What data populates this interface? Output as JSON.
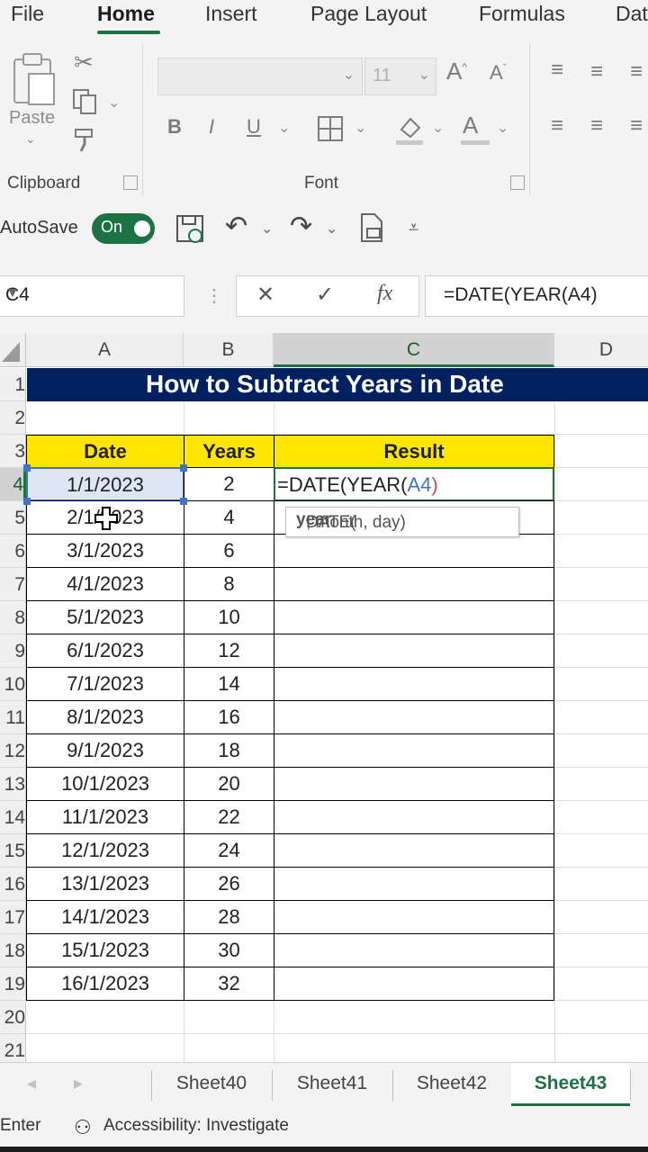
{
  "menu": {
    "tabs": [
      "File",
      "Home",
      "Insert",
      "Page Layout",
      "Formulas",
      "Dat"
    ],
    "active": "Home"
  },
  "ribbon": {
    "paste_label": "Paste",
    "font_size": "11",
    "clipboard_label": "Clipboard",
    "font_label": "Font"
  },
  "qat": {
    "autosave_label": "AutoSave",
    "toggle_label": "On"
  },
  "formula_bar": {
    "name_box": "C4",
    "formula": "=DATE(YEAR(A4)",
    "cancel_glyph": "✕",
    "enter_glyph": "✓",
    "fx_glyph": "fx"
  },
  "sheet": {
    "columns": [
      "A",
      "B",
      "C",
      "D"
    ],
    "row_numbers": [
      "1",
      "2",
      "3",
      "4",
      "5",
      "6",
      "7",
      "8",
      "9",
      "10",
      "11",
      "12",
      "13",
      "14",
      "15",
      "16",
      "17",
      "18",
      "19",
      "20",
      "21"
    ],
    "title": "How to Subtract Years in Date",
    "headers": [
      "Date",
      "Years",
      "Result"
    ],
    "dates": [
      "1/1/2023",
      "2/1/2023",
      "3/1/2023",
      "4/1/2023",
      "5/1/2023",
      "6/1/2023",
      "7/1/2023",
      "8/1/2023",
      "9/1/2023",
      "10/1/2023",
      "11/1/2023",
      "12/1/2023",
      "13/1/2023",
      "14/1/2023",
      "15/1/2023",
      "16/1/2023"
    ],
    "years": [
      "2",
      "4",
      "6",
      "8",
      "10",
      "12",
      "14",
      "16",
      "18",
      "20",
      "22",
      "24",
      "26",
      "28",
      "30",
      "32"
    ],
    "editing": {
      "prefix": "=DATE(YEAR(",
      "paren": "(",
      "ref": "A4",
      "close": ")"
    },
    "tooltip": {
      "fn": "DATE(",
      "arg": "year",
      "rest": ", month, day)"
    }
  },
  "sheet_tabs": [
    "Sheet40",
    "Sheet41",
    "Sheet42",
    "Sheet43"
  ],
  "active_sheet": "Sheet43",
  "status": {
    "mode": "Enter",
    "accessibility": "Accessibility: Investigate"
  },
  "colors": {
    "accent": "#1e7145",
    "title_bg": "#002060",
    "header_bg": "#ffe600",
    "ref_blue": "#4472c4"
  }
}
